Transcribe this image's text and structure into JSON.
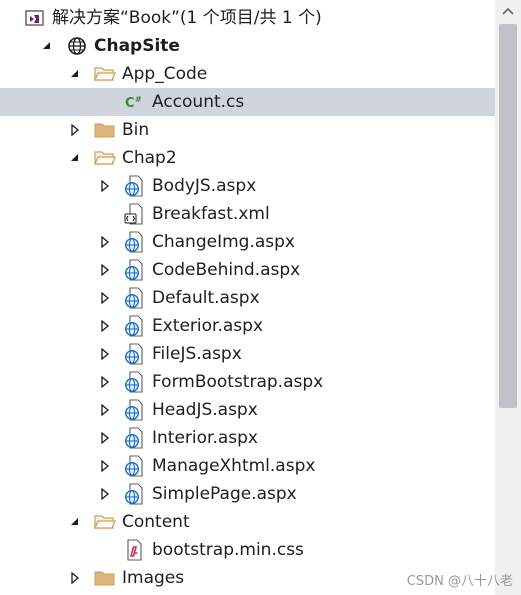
{
  "solution": {
    "title": "解决方案“Book”(1 个项目/共 1 个)",
    "icon": "solution-icon"
  },
  "tree": [
    {
      "label": "ChapSite",
      "icon": "website-icon",
      "twisty": "expanded",
      "indent": 1,
      "bold": true
    },
    {
      "label": "App_Code",
      "icon": "folder-open-icon",
      "twisty": "expanded",
      "indent": 2
    },
    {
      "label": "Account.cs",
      "icon": "csharp-file-icon",
      "twisty": "none",
      "indent": 3,
      "selected": true
    },
    {
      "label": "Bin",
      "icon": "folder-icon",
      "twisty": "collapsed",
      "indent": 2
    },
    {
      "label": "Chap2",
      "icon": "folder-open-icon",
      "twisty": "expanded",
      "indent": 2
    },
    {
      "label": "BodyJS.aspx",
      "icon": "aspx-file-icon",
      "twisty": "collapsed",
      "indent": 3
    },
    {
      "label": "Breakfast.xml",
      "icon": "xml-file-icon",
      "twisty": "none",
      "indent": 3
    },
    {
      "label": "ChangeImg.aspx",
      "icon": "aspx-file-icon",
      "twisty": "collapsed",
      "indent": 3
    },
    {
      "label": "CodeBehind.aspx",
      "icon": "aspx-file-icon",
      "twisty": "collapsed",
      "indent": 3
    },
    {
      "label": "Default.aspx",
      "icon": "aspx-file-icon",
      "twisty": "collapsed",
      "indent": 3
    },
    {
      "label": "Exterior.aspx",
      "icon": "aspx-file-icon",
      "twisty": "collapsed",
      "indent": 3
    },
    {
      "label": "FileJS.aspx",
      "icon": "aspx-file-icon",
      "twisty": "collapsed",
      "indent": 3
    },
    {
      "label": "FormBootstrap.aspx",
      "icon": "aspx-file-icon",
      "twisty": "collapsed",
      "indent": 3
    },
    {
      "label": "HeadJS.aspx",
      "icon": "aspx-file-icon",
      "twisty": "collapsed",
      "indent": 3
    },
    {
      "label": "Interior.aspx",
      "icon": "aspx-file-icon",
      "twisty": "collapsed",
      "indent": 3
    },
    {
      "label": "ManageXhtml.aspx",
      "icon": "aspx-file-icon",
      "twisty": "collapsed",
      "indent": 3
    },
    {
      "label": "SimplePage.aspx",
      "icon": "aspx-file-icon",
      "twisty": "collapsed",
      "indent": 3
    },
    {
      "label": "Content",
      "icon": "folder-open-icon",
      "twisty": "expanded",
      "indent": 2
    },
    {
      "label": "bootstrap.min.css",
      "icon": "css-file-icon",
      "twisty": "none",
      "indent": 3
    },
    {
      "label": "Images",
      "icon": "folder-icon",
      "twisty": "collapsed",
      "indent": 2
    }
  ],
  "colors": {
    "selection": "#cfd4dd",
    "folder": "#dcb67a",
    "csharp": "#388a34",
    "globe": "#1a6fc4",
    "css": "#c4314b"
  },
  "watermark": "CSDN @八十八老"
}
